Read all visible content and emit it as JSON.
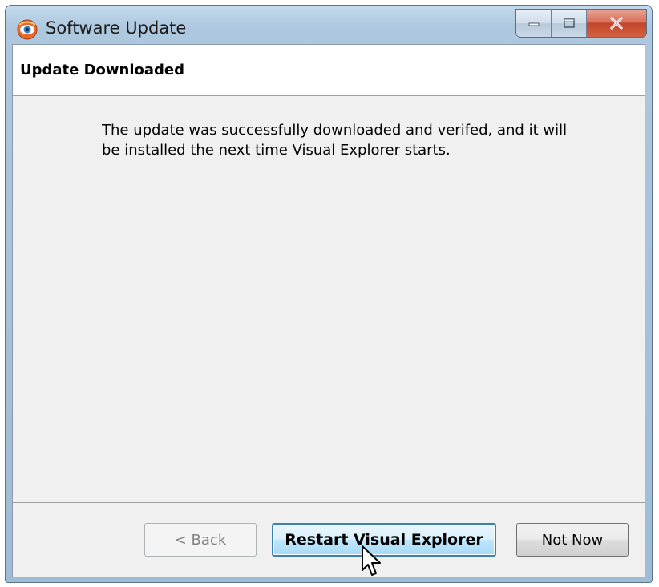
{
  "window": {
    "title": "Software Update",
    "app_icon": "app-eye-icon",
    "controls": {
      "minimize_icon": "minimize-icon",
      "maximize_icon": "maximize-icon",
      "close_icon": "close-icon"
    }
  },
  "header": {
    "title": "Update Downloaded"
  },
  "body": {
    "message_line1": "The update was successfully downloaded and verifed, and it will",
    "message_line2": "be installed the next time Visual Explorer starts."
  },
  "buttons": {
    "back_label": "< Back",
    "back_enabled": false,
    "restart_label": "Restart Visual Explorer",
    "not_now_label": "Not Now"
  },
  "colors": {
    "focus_border": "#3c7fb1",
    "close_button": "#c4452a",
    "dialog_bg": "#f0f0f0"
  },
  "cursor_icon": "arrow-pointer-icon"
}
